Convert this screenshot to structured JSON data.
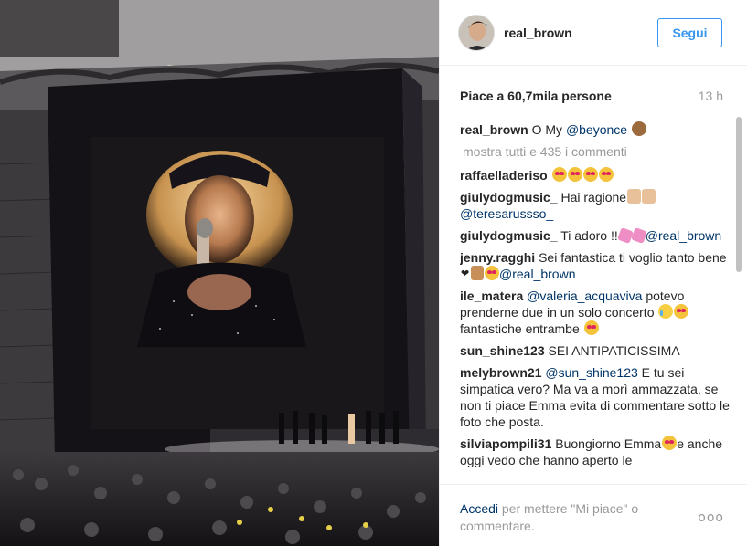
{
  "post": {
    "image_alt": "Beyoncé on a giant stadium screen during a concert"
  },
  "header": {
    "username": "real_brown",
    "follow_label": "Segui"
  },
  "meta": {
    "likes": "Piace a 60,7mila persone",
    "time": "13 h"
  },
  "caption": {
    "author": "real_brown",
    "text": "O My ",
    "mention": "@beyonce",
    "emoji": "monkey-emoji"
  },
  "load_more": "mostra tutti e 435 i commenti",
  "comments": [
    {
      "author": "raffaelladeriso",
      "text": "",
      "mention": "",
      "tail": ""
    },
    {
      "author": "giulydogmusic_",
      "text": "Hai ragione",
      "mention": "@teresarussso_",
      "tail": ""
    },
    {
      "author": "giulydogmusic_",
      "text": "Ti adoro !!",
      "mention": "@real_brown",
      "tail": ""
    },
    {
      "author": "jenny.ragghi",
      "text": "Sei fantastica ti voglio tanto bene",
      "mention": "@real_brown",
      "tail": ""
    },
    {
      "author": "ile_matera",
      "text": "",
      "mention": "@valeria_acquaviva",
      "tail": " potevo prenderne due in un solo concerto ",
      "tail2": " fantastiche entrambe "
    },
    {
      "author": "sun_shine123",
      "text": "SEI ANTIPATICISSIMA",
      "mention": "",
      "tail": ""
    },
    {
      "author": "melybrown21",
      "text": "",
      "mention": "@sun_shine123",
      "tail": " E tu sei simpatica vero? Ma va a morì ammazzata, se non ti piace Emma evita di commentare sotto le foto che posta."
    },
    {
      "author": "silviapompili31",
      "text": "Buongiorno Emma",
      "mention": "",
      "tail": "e anche oggi vedo che hanno aperto le"
    }
  ],
  "footer": {
    "login_label": "Accedi",
    "prompt": " per mettere \"Mi piace\" o commentare.",
    "more_label": "ooo"
  },
  "colors": {
    "accent": "#3897f0",
    "link": "#003569",
    "muted": "#999999"
  }
}
